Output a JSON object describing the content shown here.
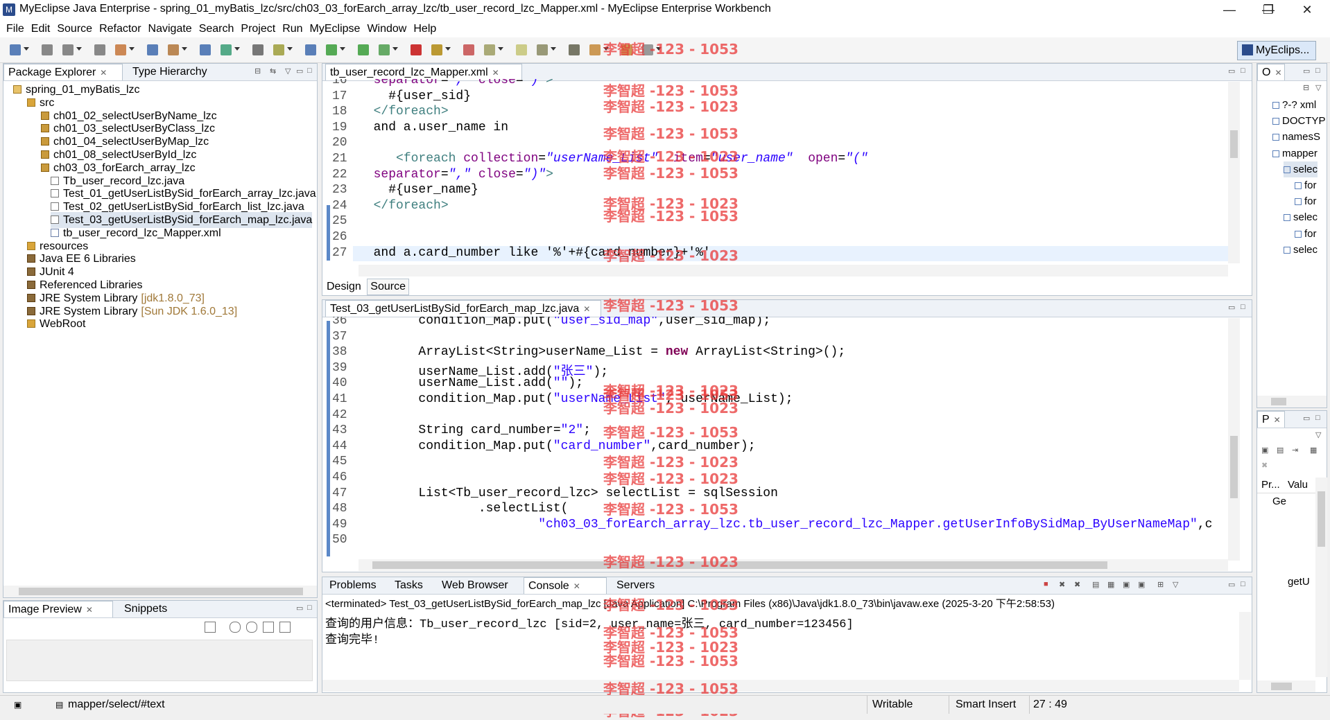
{
  "window": {
    "title": "MyEclipse Java Enterprise - spring_01_myBatis_lzc/src/ch03_03_forEarch_array_lzc/tb_user_record_lzc_Mapper.xml - MyEclipse Enterprise Workbench",
    "minimize": "—",
    "restore": "❐",
    "close": "✕"
  },
  "menu": [
    "File",
    "Edit",
    "Source",
    "Refactor",
    "Navigate",
    "Search",
    "Project",
    "Run",
    "MyEclipse",
    "Window",
    "Help"
  ],
  "perspective": {
    "label": "MyEclips..."
  },
  "package_explorer": {
    "tabs": [
      {
        "label": "Package Explorer",
        "close": "✕"
      },
      {
        "label": "Type Hierarchy",
        "close": ""
      }
    ],
    "tree": [
      {
        "label": "spring_01_myBatis_lzc",
        "extra": "",
        "icon": "project-icon",
        "depth": 0
      },
      {
        "label": "src",
        "extra": "",
        "icon": "source-folder-icon",
        "depth": 1
      },
      {
        "label": "ch01_02_selectUserByName_lzc",
        "extra": "",
        "icon": "package-icon",
        "depth": 2
      },
      {
        "label": "ch01_03_selectUserByClass_lzc",
        "extra": "",
        "icon": "package-icon",
        "depth": 2
      },
      {
        "label": "ch01_04_selectUserByMap_lzc",
        "extra": "",
        "icon": "package-icon",
        "depth": 2
      },
      {
        "label": "ch01_08_selectUserById_lzc",
        "extra": "",
        "icon": "package-icon",
        "depth": 2
      },
      {
        "label": "ch03_03_forEarch_array_lzc",
        "extra": "",
        "icon": "package-icon",
        "depth": 2
      },
      {
        "label": "Tb_user_record_lzc.java",
        "extra": "",
        "icon": "java-file-icon",
        "depth": 3
      },
      {
        "label": "Test_01_getUserListBySid_forEarch_array_lzc.java",
        "extra": "",
        "icon": "java-file-icon",
        "depth": 3
      },
      {
        "label": "Test_02_getUserListBySid_forEarch_list_lzc.java",
        "extra": "",
        "icon": "java-file-icon",
        "depth": 3
      },
      {
        "label": "Test_03_getUserListBySid_forEarch_map_lzc.java",
        "extra": "",
        "icon": "java-file-icon",
        "depth": 3,
        "selected": true
      },
      {
        "label": "tb_user_record_lzc_Mapper.xml",
        "extra": "",
        "icon": "xml-file-icon",
        "depth": 3
      },
      {
        "label": "resources",
        "extra": "",
        "icon": "folder-icon",
        "depth": 1
      },
      {
        "label": "Java EE 6 Libraries",
        "extra": "",
        "icon": "library-icon",
        "depth": 1
      },
      {
        "label": "JUnit 4",
        "extra": "",
        "icon": "library-icon",
        "depth": 1
      },
      {
        "label": "Referenced Libraries",
        "extra": "",
        "icon": "library-icon",
        "depth": 1
      },
      {
        "label": "JRE System Library",
        "extra": "[jdk1.8.0_73]",
        "icon": "library-icon",
        "depth": 1
      },
      {
        "label": "JRE System Library",
        "extra": "[Sun JDK 1.6.0_13]",
        "icon": "library-icon",
        "depth": 1
      },
      {
        "label": "WebRoot",
        "extra": "",
        "icon": "folder-icon",
        "depth": 1
      }
    ]
  },
  "image_preview": {
    "tabs": [
      {
        "label": "Image Preview",
        "close": "✕"
      },
      {
        "label": "Snippets",
        "close": ""
      }
    ]
  },
  "xml_editor": {
    "tab": "tb_user_record_lzc_Mapper.xml",
    "lines": [
      {
        "n": "16",
        "parts": [
          [
            "plain",
            "  "
          ],
          [
            "attr",
            "separator"
          ],
          [
            "plain",
            "="
          ],
          [
            "val",
            "\",\""
          ],
          [
            "plain",
            " "
          ],
          [
            "attr",
            "close"
          ],
          [
            "plain",
            "="
          ],
          [
            "val",
            "\")\""
          ],
          [
            "tag",
            ">"
          ]
        ]
      },
      {
        "n": "17",
        "parts": [
          [
            "plain",
            "    #{user_sid}"
          ]
        ]
      },
      {
        "n": "18",
        "parts": [
          [
            "plain",
            "  "
          ],
          [
            "tag",
            "</foreach>"
          ]
        ]
      },
      {
        "n": "19",
        "parts": [
          [
            "plain",
            "  and a.user_name in"
          ]
        ]
      },
      {
        "n": "20",
        "parts": [
          [
            "plain",
            ""
          ]
        ]
      },
      {
        "n": "21",
        "parts": [
          [
            "plain",
            "     "
          ],
          [
            "tag",
            "<foreach"
          ],
          [
            "plain",
            " "
          ],
          [
            "attr",
            "collection"
          ],
          [
            "plain",
            "="
          ],
          [
            "val",
            "\"userName_List\""
          ],
          [
            "plain",
            "  "
          ],
          [
            "attr",
            "item"
          ],
          [
            "plain",
            "="
          ],
          [
            "val",
            "\"user_name\""
          ],
          [
            "plain",
            "  "
          ],
          [
            "attr",
            "open"
          ],
          [
            "plain",
            "="
          ],
          [
            "val",
            "\"(\""
          ]
        ]
      },
      {
        "n": "22",
        "parts": [
          [
            "plain",
            "  "
          ],
          [
            "attr",
            "separator"
          ],
          [
            "plain",
            "="
          ],
          [
            "val",
            "\",\""
          ],
          [
            "plain",
            " "
          ],
          [
            "attr",
            "close"
          ],
          [
            "plain",
            "="
          ],
          [
            "val",
            "\")\""
          ],
          [
            "tag",
            ">"
          ]
        ]
      },
      {
        "n": "23",
        "parts": [
          [
            "plain",
            "    #{user_name}"
          ]
        ]
      },
      {
        "n": "24",
        "parts": [
          [
            "plain",
            "  "
          ],
          [
            "tag",
            "</foreach>"
          ]
        ]
      },
      {
        "n": "25",
        "parts": [
          [
            "plain",
            ""
          ]
        ]
      },
      {
        "n": "26",
        "parts": [
          [
            "plain",
            ""
          ]
        ]
      },
      {
        "n": "27",
        "parts": [
          [
            "plain",
            "  and a.card_number like '%'+#{card_number}+'%'"
          ]
        ]
      }
    ],
    "bottom_tabs": [
      "Design",
      "Source"
    ]
  },
  "java_editor": {
    "tab": "Test_03_getUserListBySid_forEarch_map_lzc.java",
    "lines": [
      {
        "n": "36",
        "parts": [
          [
            "plain",
            "        condition_Map.put("
          ],
          [
            "str",
            "\"user_sid_map\""
          ],
          [
            "plain",
            ",user_sid_map);"
          ]
        ]
      },
      {
        "n": "37",
        "parts": [
          [
            "plain",
            ""
          ]
        ]
      },
      {
        "n": "38",
        "parts": [
          [
            "plain",
            "        ArrayList<String>userName_List = "
          ],
          [
            "kw",
            "new"
          ],
          [
            "plain",
            " ArrayList<String>();"
          ]
        ]
      },
      {
        "n": "39",
        "parts": [
          [
            "plain",
            "        userName_List.add("
          ],
          [
            "str",
            "\"张三\""
          ],
          [
            "plain",
            ");"
          ]
        ]
      },
      {
        "n": "40",
        "parts": [
          [
            "plain",
            "        userName_List.add("
          ],
          [
            "str",
            "\"\""
          ],
          [
            "plain",
            ");"
          ]
        ]
      },
      {
        "n": "41",
        "parts": [
          [
            "plain",
            "        condition_Map.put("
          ],
          [
            "str",
            "\"userName_List\""
          ],
          [
            "plain",
            ", userName_List);"
          ]
        ]
      },
      {
        "n": "42",
        "parts": [
          [
            "plain",
            ""
          ]
        ]
      },
      {
        "n": "43",
        "parts": [
          [
            "plain",
            "        String card_number="
          ],
          [
            "str",
            "\"2\""
          ],
          [
            "plain",
            ";"
          ]
        ]
      },
      {
        "n": "44",
        "parts": [
          [
            "plain",
            "        condition_Map.put("
          ],
          [
            "str",
            "\"card_number\""
          ],
          [
            "plain",
            ",card_number);"
          ]
        ]
      },
      {
        "n": "45",
        "parts": [
          [
            "plain",
            ""
          ]
        ]
      },
      {
        "n": "46",
        "parts": [
          [
            "plain",
            ""
          ]
        ]
      },
      {
        "n": "47",
        "parts": [
          [
            "plain",
            "        List<Tb_user_record_lzc> selectList = sqlSession"
          ]
        ]
      },
      {
        "n": "48",
        "parts": [
          [
            "plain",
            "                .selectList("
          ]
        ]
      },
      {
        "n": "49",
        "parts": [
          [
            "plain",
            "                        "
          ],
          [
            "str",
            "\"ch03_03_forEarch_array_lzc.tb_user_record_lzc_Mapper.getUserInfoBySidMap_ByUserNameMap\""
          ],
          [
            "plain",
            ",c"
          ]
        ]
      },
      {
        "n": "50",
        "parts": [
          [
            "plain",
            ""
          ]
        ]
      }
    ]
  },
  "console": {
    "tabs": [
      {
        "label": "Problems",
        "close": ""
      },
      {
        "label": "Tasks",
        "close": ""
      },
      {
        "label": "Web Browser",
        "close": ""
      },
      {
        "label": "Console",
        "close": "✕"
      },
      {
        "label": "Servers",
        "close": ""
      }
    ],
    "header": "<terminated> Test_03_getUserListBySid_forEarch_map_lzc [Java Application] C:\\Program Files (x86)\\Java\\jdk1.8.0_73\\bin\\javaw.exe (2025-3-20 下午2:58:53)",
    "output": [
      "查询的用户信息：Tb_user_record_lzc [sid=2, user_name=张三, card_number=123456]",
      "查询完毕!"
    ]
  },
  "outline": {
    "tab": "O",
    "items": [
      {
        "label": "?-? xml",
        "depth": 0
      },
      {
        "label": "DOCTYP",
        "depth": 0
      },
      {
        "label": "namesS",
        "depth": 0
      },
      {
        "label": "mapper",
        "depth": 0
      },
      {
        "label": "selec",
        "depth": 1,
        "selected": true
      },
      {
        "label": "for",
        "depth": 2
      },
      {
        "label": "for",
        "depth": 2
      },
      {
        "label": "selec",
        "depth": 1
      },
      {
        "label": "for",
        "depth": 2
      },
      {
        "label": "selec",
        "depth": 1
      }
    ]
  },
  "properties": {
    "tab": "P",
    "col1": "Pr...",
    "col2": "Valu",
    "row1": "Ge",
    "row2": "getU"
  },
  "watermarks": [
    "李智超 -123 - 1053",
    "李智超 -123 - 1023"
  ],
  "statusbar": {
    "path": "mapper/select/#text",
    "writable": "Writable",
    "insert": "Smart Insert",
    "position": "27 : 49"
  }
}
